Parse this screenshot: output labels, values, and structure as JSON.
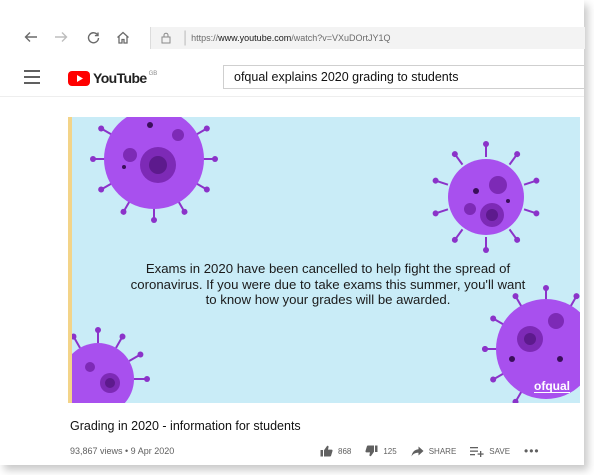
{
  "browser": {
    "url_prefix": "https://",
    "url_domain": "www.youtube.com",
    "url_path": "/watch?v=VXuDOrtJY1Q"
  },
  "youtube": {
    "logo_text": "YouTube",
    "region": "GB",
    "search_value": "ofqual explains 2020 grading to students"
  },
  "video": {
    "caption": "Exams in 2020 have been cancelled to help fight the spread of coronavirus. If you were due to take exams this summer, you'll want to know how your grades will be awarded.",
    "watermark": "ofqual",
    "title": "Grading in 2020 - information for students",
    "meta": "93,867 views • 9 Apr 2020"
  },
  "actions": {
    "like_count": "868",
    "dislike_count": "125",
    "share_label": "SHARE",
    "save_label": "SAVE",
    "more_label": "•••"
  },
  "colors": {
    "video_background": "#c9ecf7",
    "virus_purple": "#9b3fe0",
    "youtube_red": "#ff0000"
  }
}
